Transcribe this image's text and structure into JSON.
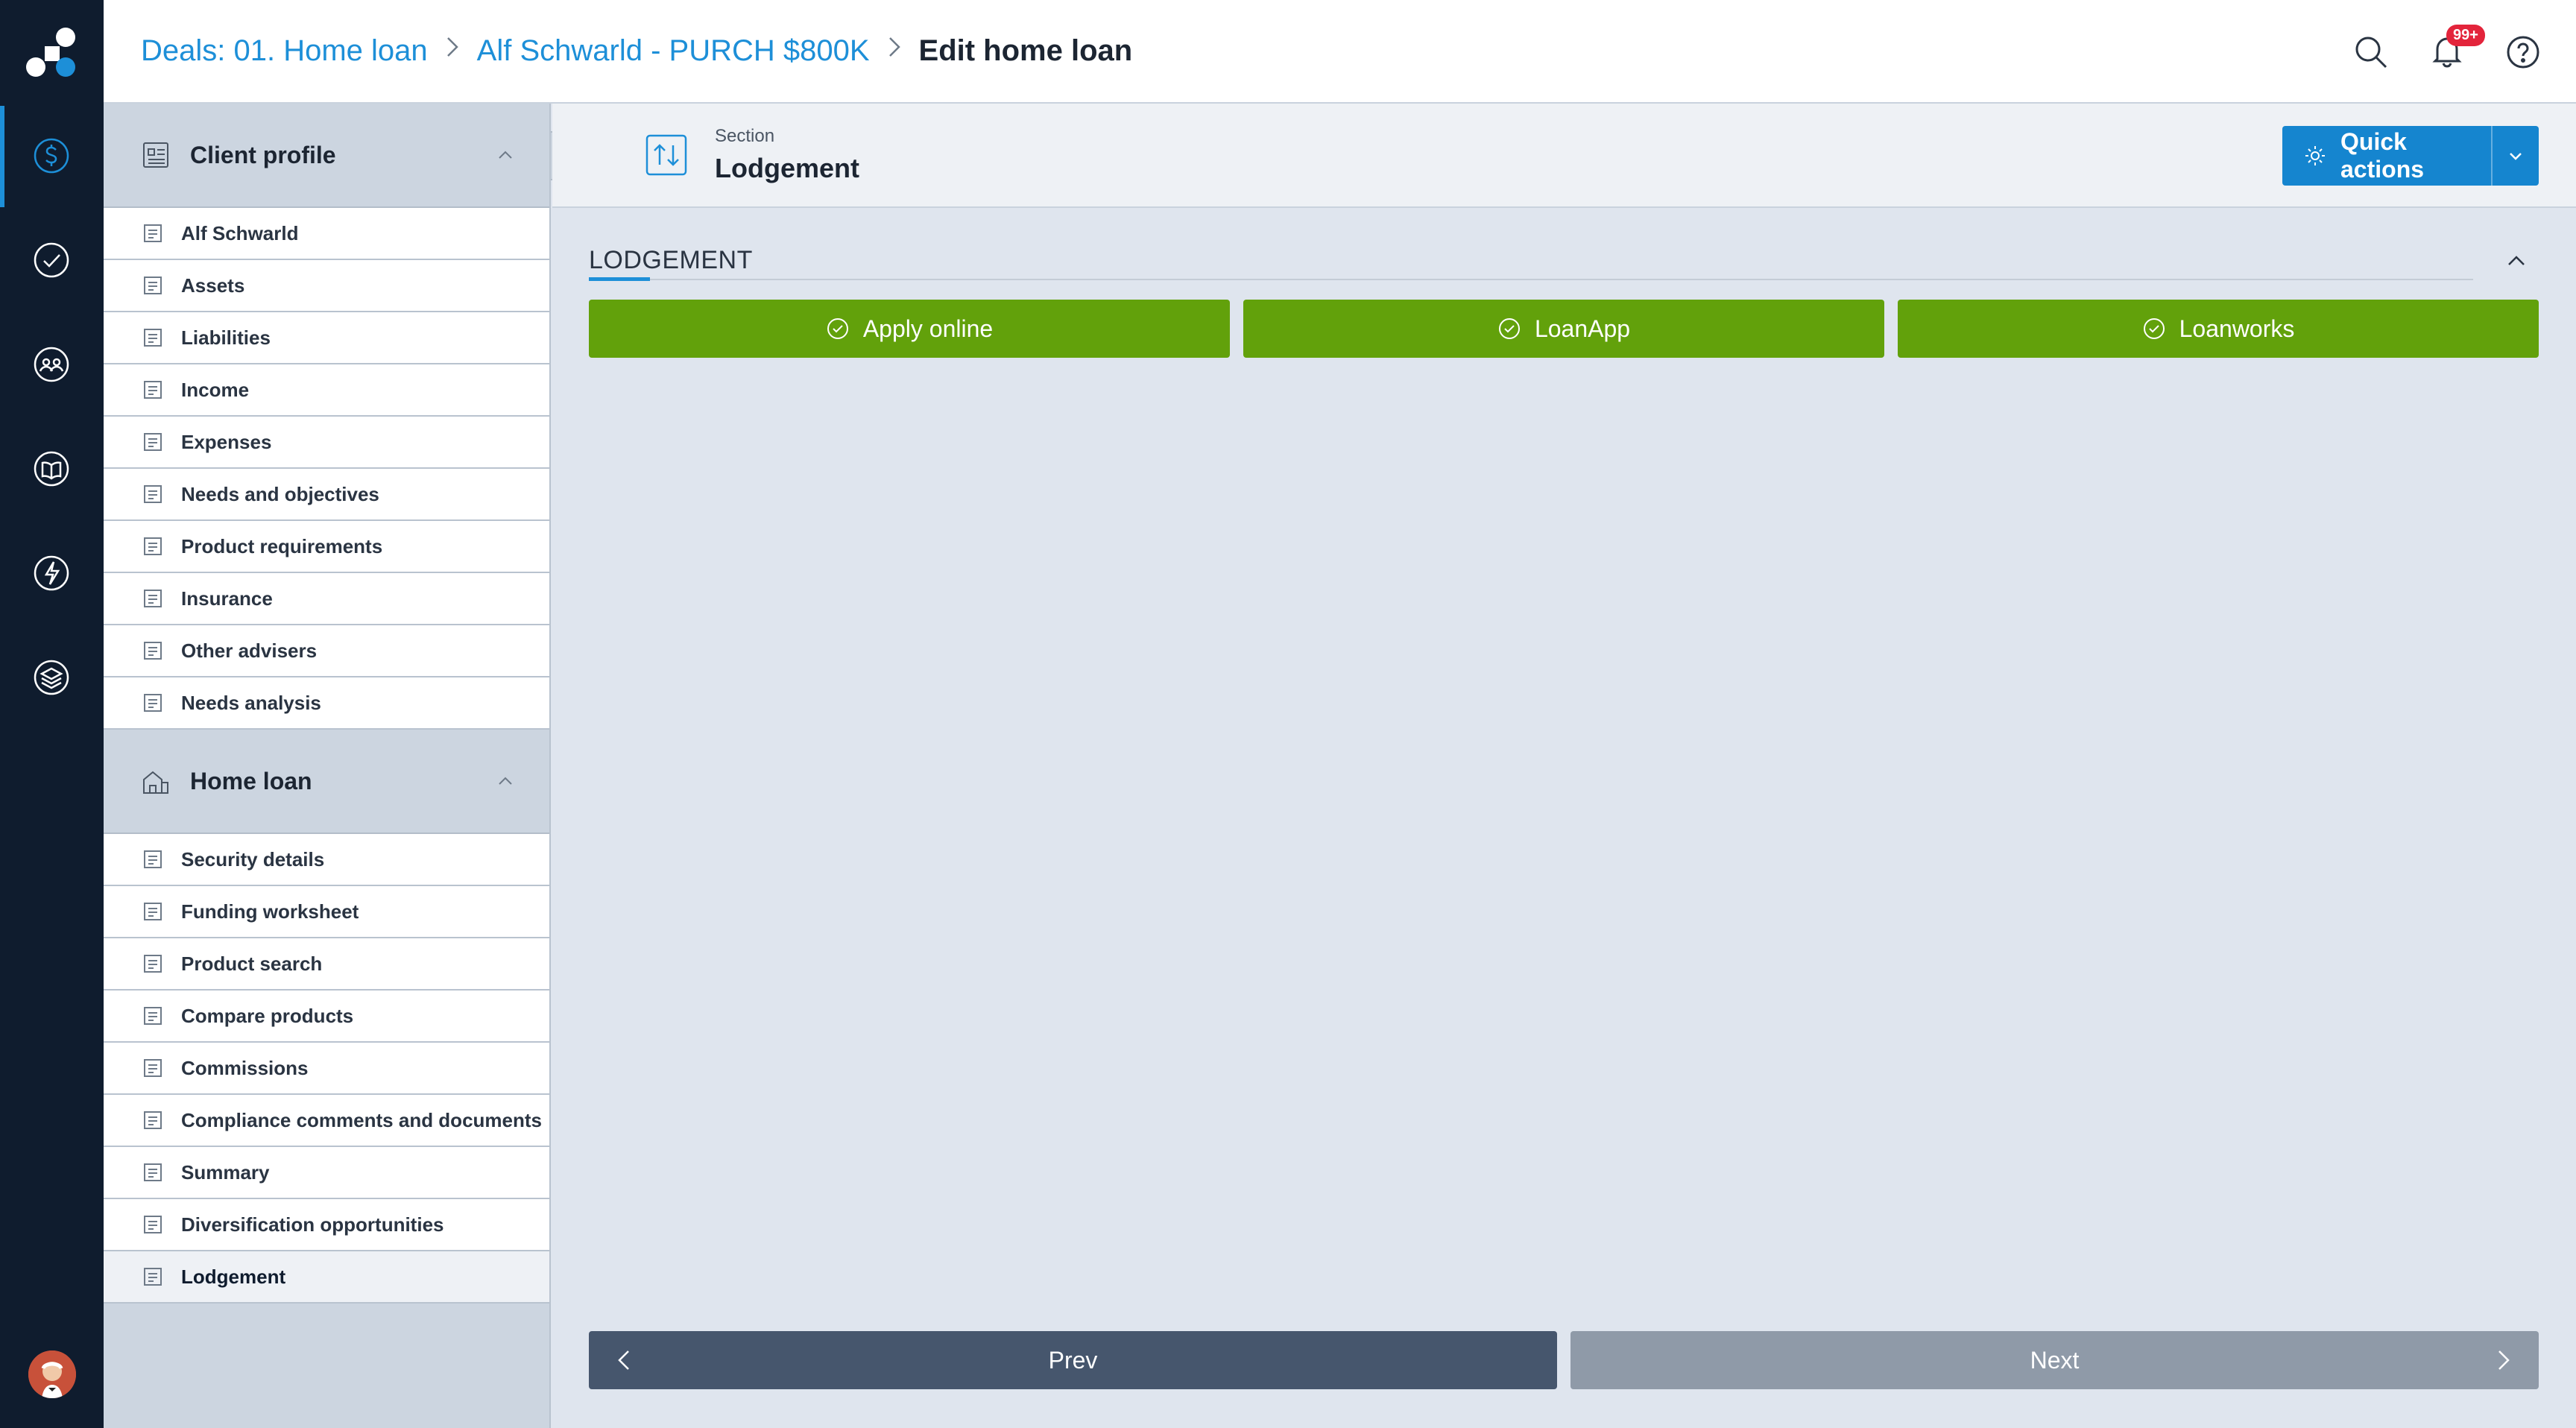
{
  "breadcrumb": {
    "deals": "Deals: 01. Home loan",
    "client": "Alf Schwarld - PURCH $800K",
    "current": "Edit home loan"
  },
  "header": {
    "notification_count": "99+"
  },
  "sidebar": {
    "client_profile": {
      "title": "Client profile",
      "items": [
        {
          "label": "Alf Schwarld",
          "icon": "dollar-circle-icon"
        },
        {
          "label": "Assets",
          "icon": "assets-icon"
        },
        {
          "label": "Liabilities",
          "icon": "liabilities-icon"
        },
        {
          "label": "Income",
          "icon": "wallet-icon"
        },
        {
          "label": "Expenses",
          "icon": "cart-icon"
        },
        {
          "label": "Needs and objectives",
          "icon": "target-icon"
        },
        {
          "label": "Product requirements",
          "icon": "book-icon"
        },
        {
          "label": "Insurance",
          "icon": "shield-icon"
        },
        {
          "label": "Other advisers",
          "icon": "people-icon"
        },
        {
          "label": "Needs analysis",
          "icon": "analysis-icon"
        }
      ]
    },
    "home_loan": {
      "title": "Home loan",
      "items": [
        {
          "label": "Security details",
          "icon": "house-key-icon"
        },
        {
          "label": "Funding worksheet",
          "icon": "worksheet-icon"
        },
        {
          "label": "Product search",
          "icon": "search-doc-icon"
        },
        {
          "label": "Compare products",
          "icon": "compare-icon"
        },
        {
          "label": "Commissions",
          "icon": "commission-icon"
        },
        {
          "label": "Compliance comments and documents",
          "icon": "compliance-icon"
        },
        {
          "label": "Summary",
          "icon": "summary-icon"
        },
        {
          "label": "Diversification opportunities",
          "icon": "diversify-icon"
        },
        {
          "label": "Lodgement",
          "icon": "lodgement-icon"
        }
      ]
    }
  },
  "section": {
    "small_label": "Section",
    "title": "Lodgement"
  },
  "quick_actions": {
    "label": "Quick actions"
  },
  "lodgement": {
    "heading": "LODGEMENT",
    "buttons": [
      "Apply online",
      "LoanApp",
      "Loanworks"
    ]
  },
  "pager": {
    "prev": "Prev",
    "next": "Next"
  },
  "colors": {
    "rail": "#0f1c2e",
    "accent": "#1d8fd8",
    "green": "#62a10b",
    "prev_button": "#46566d",
    "next_button": "#8f9aa8",
    "badge": "#e3243b"
  }
}
